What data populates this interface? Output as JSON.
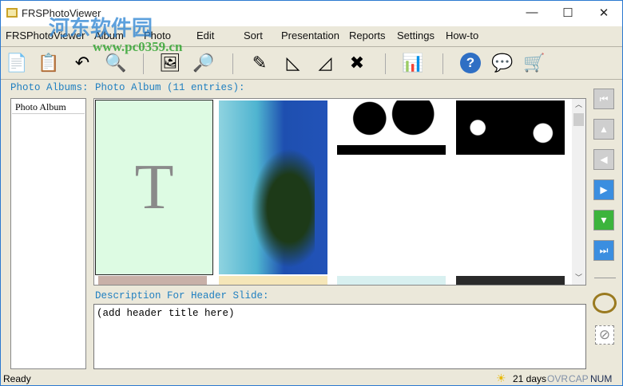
{
  "window": {
    "title": "FRSPhotoViewer",
    "minimize": "—",
    "maximize": "☐",
    "close": "✕"
  },
  "menu": [
    "FRSPhotoViewer",
    "Album",
    "Photo",
    "Edit",
    "Sort",
    "Presentation",
    "Reports",
    "Settings",
    "How-to"
  ],
  "toolbar": [
    {
      "name": "copy-icon",
      "glyph": "📄"
    },
    {
      "name": "paste-icon",
      "glyph": "📋"
    },
    {
      "name": "undo-icon",
      "glyph": "↶"
    },
    {
      "name": "find-icon",
      "glyph": "🔍"
    },
    {
      "name": "add-photo-icon",
      "glyph": "🖼"
    },
    {
      "name": "view-photo-icon",
      "glyph": "🔎"
    },
    {
      "name": "edit-photo-icon",
      "glyph": "✎"
    },
    {
      "name": "rotate-left-icon",
      "glyph": "◺"
    },
    {
      "name": "rotate-right-icon",
      "glyph": "◿"
    },
    {
      "name": "delete-photo-icon",
      "glyph": "✖"
    },
    {
      "name": "presentation-icon",
      "glyph": "📊"
    },
    {
      "name": "help-icon",
      "glyph": "?"
    },
    {
      "name": "feedback-icon",
      "glyph": "💬"
    },
    {
      "name": "shop-cart-icon",
      "glyph": "🛒"
    }
  ],
  "albums_label": "Photo Albums:",
  "albums": [
    "Photo Album"
  ],
  "album_header": "Photo Album (11 entries):",
  "header_slide_letter": "T",
  "description_label": "Description For Header Slide:",
  "description_value": "(add header title here)",
  "status": {
    "ready": "Ready",
    "days": "21 days",
    "ovr": "OVR",
    "cap": "CAP",
    "num": "NUM"
  },
  "watermark": {
    "cn": "河东软件园",
    "url": "www.pc0359.cn"
  },
  "colors": {
    "label": "#1f7fc0",
    "nav_blue": "#3b8ee0",
    "nav_green": "#3cb43c",
    "nav_gray": "#c8c8c8"
  }
}
